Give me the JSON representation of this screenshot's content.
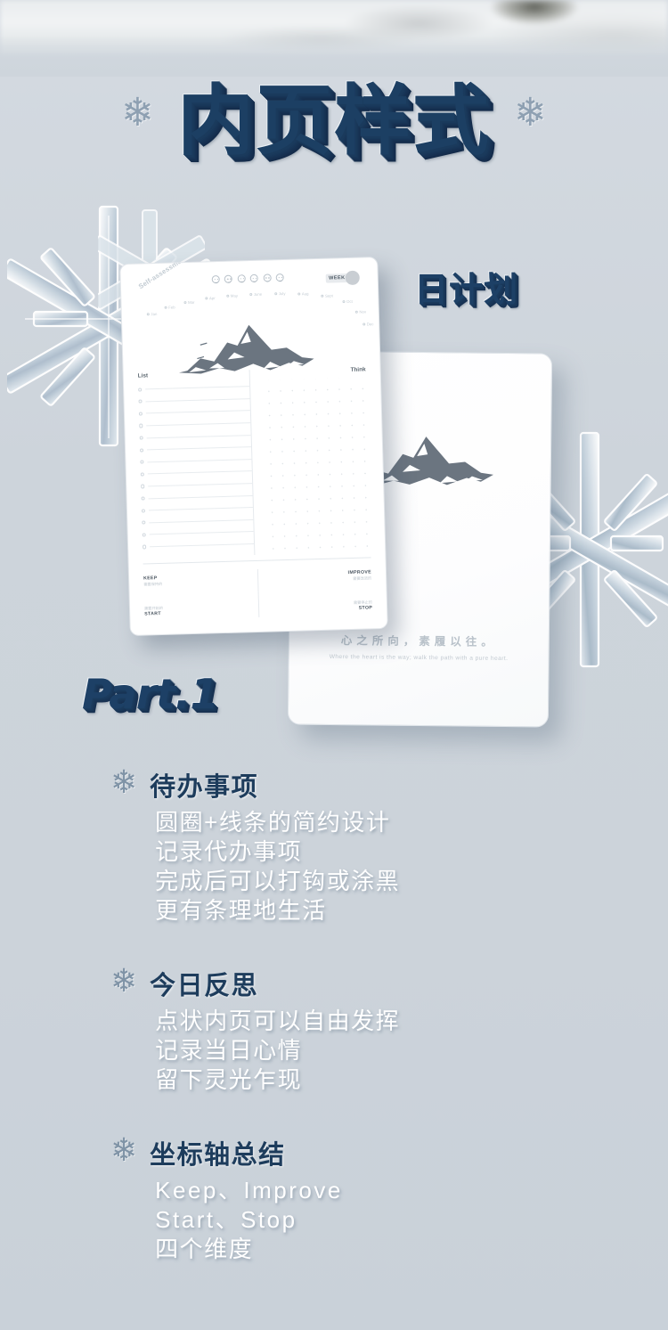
{
  "colors": {
    "background": "#ced5dc",
    "title_blue": "#1d4066",
    "body_white": "#ffffff",
    "flake_slate": "#7f93a6"
  },
  "header": {
    "title": "内页样式",
    "left_flake_icon": "snowflake-icon",
    "right_flake_icon": "snowflake-icon"
  },
  "showcase": {
    "sub_title": "日计划",
    "part_label": "Part.1",
    "front_page": {
      "arc_label": "Self-assessment",
      "months": [
        "Jan",
        "Feb",
        "Mar",
        "Apr",
        "May",
        "June",
        "July",
        "Aug",
        "Sept",
        "Oct",
        "Nov",
        "Dec"
      ],
      "week_label": "WEEK:",
      "mood_faces": [
        "face-happy-icon",
        "face-smile-icon",
        "face-neutral-icon",
        "face-grin-icon",
        "face-sad-icon",
        "face-dizzy-icon"
      ],
      "col_left_head": "List",
      "col_right_head": "Think",
      "quadrants": [
        {
          "en": "KEEP",
          "cn": "需要保持的"
        },
        {
          "en": "IMPROVE",
          "cn": "需要改进的"
        },
        {
          "en": "START",
          "cn": "需要开始的"
        },
        {
          "en": "STOP",
          "cn": "需要停止的"
        }
      ],
      "list_rows": 14
    },
    "back_page": {
      "quote_cn": "心之所向，素履以往。",
      "quote_en": "Where the heart is the way; walk the path with a pure heart."
    }
  },
  "features": [
    {
      "flake_icon": "snowflake-icon",
      "title": "待办事项",
      "lines": [
        "圆圈+线条的简约设计",
        "记录代办事项",
        "完成后可以打钩或涂黑",
        "更有条理地生活"
      ]
    },
    {
      "flake_icon": "snowflake-icon",
      "title": "今日反思",
      "lines": [
        "点状内页可以自由发挥",
        "记录当日心情",
        "留下灵光乍现"
      ]
    },
    {
      "flake_icon": "snowflake-icon",
      "title": "坐标轴总结",
      "lines": [
        "Keep、Improve",
        "Start、Stop",
        "四个维度"
      ]
    }
  ]
}
